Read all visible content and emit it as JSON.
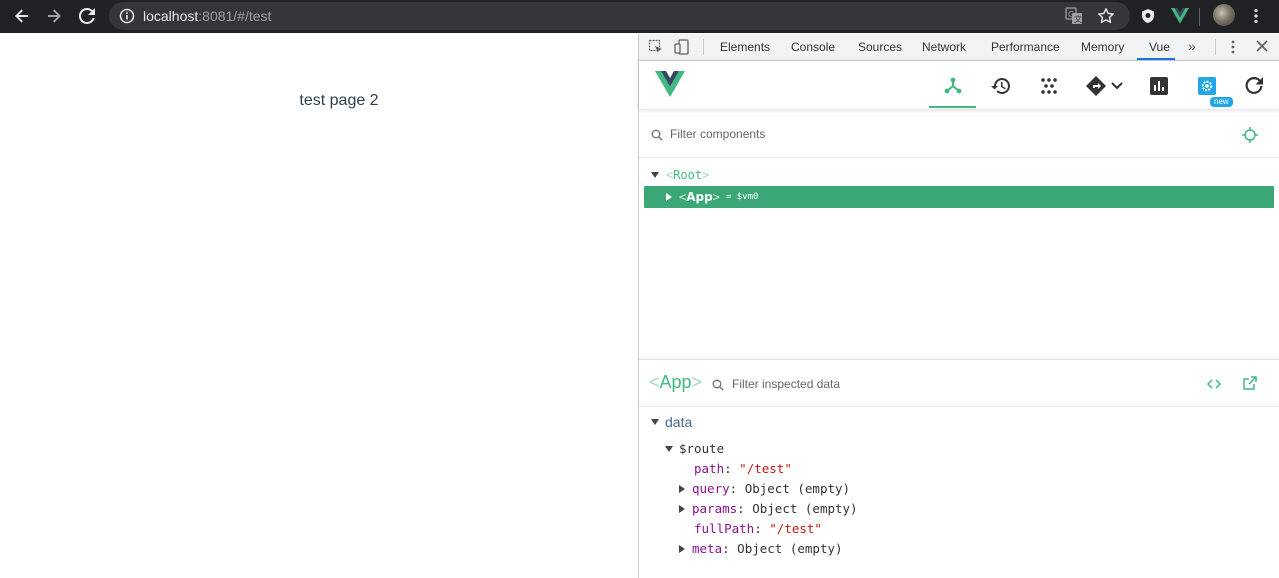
{
  "browser": {
    "url_host": "localhost",
    "url_rest": ":8081/#/test"
  },
  "page": {
    "text": "test page 2"
  },
  "devtools": {
    "tabs": [
      {
        "label": "Elements"
      },
      {
        "label": "Console"
      },
      {
        "label": "Sources"
      },
      {
        "label": "Network"
      },
      {
        "label": "Performance"
      },
      {
        "label": "Memory"
      },
      {
        "label": "Vue"
      }
    ],
    "active_tab": "Vue",
    "new_badge": "new",
    "filter_components_placeholder": "Filter components",
    "tree": {
      "root_name": "Root",
      "app_name": "App",
      "app_vm": "= $vm0"
    },
    "inspector": {
      "component": "App",
      "filter_placeholder": "Filter inspected data",
      "section": "data",
      "route_key": "$route",
      "props": [
        {
          "key": "path",
          "value": "\"/test\"",
          "kind": "string",
          "expandable": false
        },
        {
          "key": "query",
          "value": "Object (empty)",
          "kind": "object",
          "expandable": true
        },
        {
          "key": "params",
          "value": "Object (empty)",
          "kind": "object",
          "expandable": true
        },
        {
          "key": "fullPath",
          "value": "\"/test\"",
          "kind": "string",
          "expandable": false
        },
        {
          "key": "meta",
          "value": "Object (empty)",
          "kind": "object",
          "expandable": true
        }
      ]
    }
  },
  "colors": {
    "vue_green": "#42b983",
    "selected_row": "#3ba776",
    "chrome_dark": "#202124"
  }
}
